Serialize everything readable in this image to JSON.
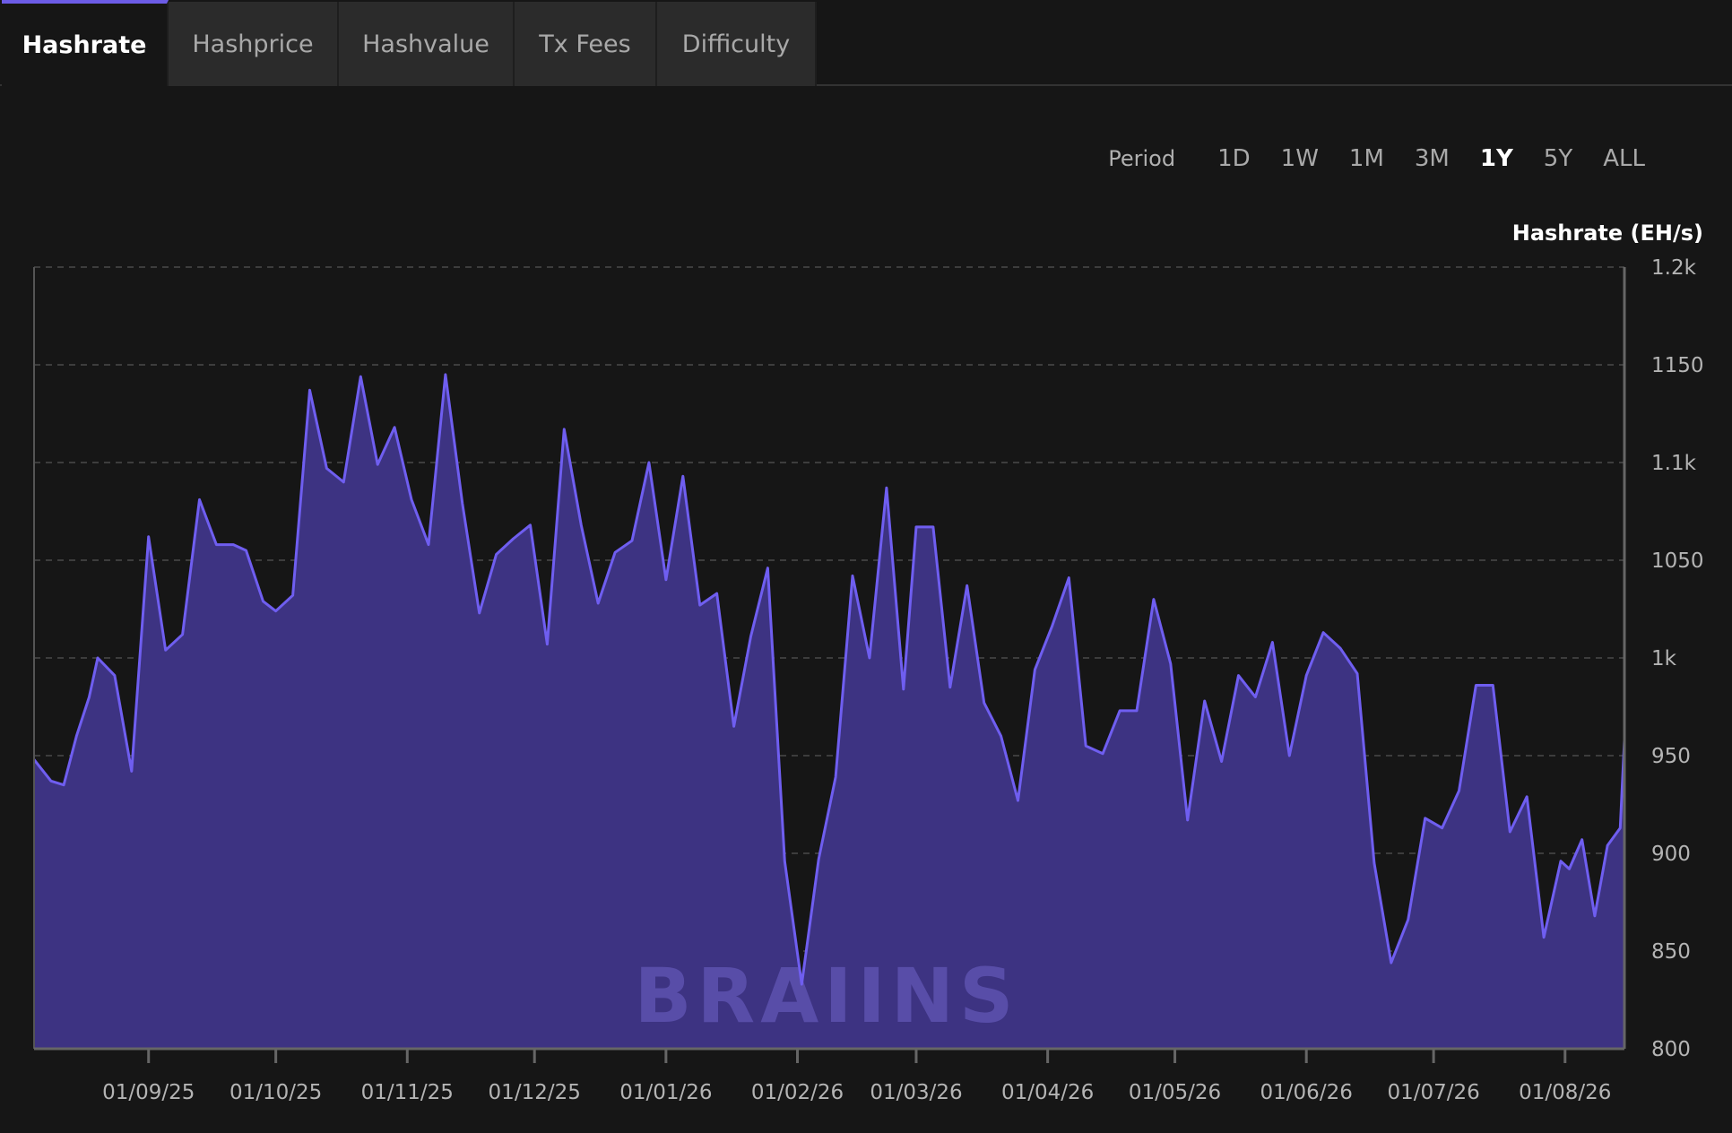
{
  "tabs": [
    {
      "label": "Hashrate",
      "active": true
    },
    {
      "label": "Hashprice",
      "active": false
    },
    {
      "label": "Hashvalue",
      "active": false
    },
    {
      "label": "Tx Fees",
      "active": false
    },
    {
      "label": "Difficulty",
      "active": false
    }
  ],
  "period": {
    "label": "Period",
    "options": [
      "1D",
      "1W",
      "1M",
      "3M",
      "1Y",
      "5Y",
      "ALL"
    ],
    "selected": "1Y"
  },
  "watermark": "BRAIINS",
  "colors": {
    "accent": "#6c5ce7",
    "line": "#6f5ef0",
    "area": "#3d3382",
    "background": "#161616"
  },
  "chart_data": {
    "type": "area",
    "ylabel": "Hashrate (EH/s)",
    "y_ticks": [
      800,
      850,
      900,
      950,
      1000,
      1050,
      1100,
      1150,
      1200
    ],
    "y_tick_labels": [
      "800",
      "850",
      "900",
      "950",
      "1k",
      "1050",
      "1.1k",
      "1150",
      "1.2k"
    ],
    "ylim": [
      800,
      1200
    ],
    "y_scale": "linear",
    "x_range": [
      "2025-08-05",
      "2026-08-15"
    ],
    "x_ticks": [
      "2025-09-01",
      "2025-10-01",
      "2025-11-01",
      "2025-12-01",
      "2026-01-01",
      "2026-02-01",
      "2026-03-01",
      "2026-04-01",
      "2026-05-01",
      "2026-06-01",
      "2026-07-01",
      "2026-08-01"
    ],
    "x_tick_labels": [
      "01/09/25",
      "01/10/25",
      "01/11/25",
      "01/12/25",
      "01/01/26",
      "01/02/26",
      "01/03/26",
      "01/04/26",
      "01/05/26",
      "01/06/26",
      "01/07/26",
      "01/08/26"
    ],
    "grid": true,
    "series": [
      {
        "values": [
          [
            "2025-08-05",
            948
          ],
          [
            "2025-08-09",
            937
          ],
          [
            "2025-08-12",
            935
          ],
          [
            "2025-08-15",
            960
          ],
          [
            "2025-08-18",
            980
          ],
          [
            "2025-08-20",
            1000
          ],
          [
            "2025-08-24",
            991
          ],
          [
            "2025-08-28",
            942
          ],
          [
            "2025-09-01",
            1062
          ],
          [
            "2025-09-05",
            1004
          ],
          [
            "2025-09-09",
            1012
          ],
          [
            "2025-09-13",
            1081
          ],
          [
            "2025-09-17",
            1058
          ],
          [
            "2025-09-21",
            1058
          ],
          [
            "2025-09-24",
            1055
          ],
          [
            "2025-09-28",
            1029
          ],
          [
            "2025-10-01",
            1024
          ],
          [
            "2025-10-05",
            1032
          ],
          [
            "2025-10-09",
            1137
          ],
          [
            "2025-10-13",
            1097
          ],
          [
            "2025-10-17",
            1090
          ],
          [
            "2025-10-21",
            1144
          ],
          [
            "2025-10-25",
            1099
          ],
          [
            "2025-10-29",
            1118
          ],
          [
            "2025-11-02",
            1081
          ],
          [
            "2025-11-06",
            1058
          ],
          [
            "2025-11-10",
            1145
          ],
          [
            "2025-11-14",
            1079
          ],
          [
            "2025-11-18",
            1023
          ],
          [
            "2025-11-22",
            1053
          ],
          [
            "2025-11-26",
            1061
          ],
          [
            "2025-11-30",
            1068
          ],
          [
            "2025-12-04",
            1007
          ],
          [
            "2025-12-08",
            1117
          ],
          [
            "2025-12-12",
            1068
          ],
          [
            "2025-12-16",
            1028
          ],
          [
            "2025-12-20",
            1054
          ],
          [
            "2025-12-24",
            1060
          ],
          [
            "2025-12-28",
            1100
          ],
          [
            "2026-01-01",
            1040
          ],
          [
            "2026-01-05",
            1093
          ],
          [
            "2026-01-09",
            1027
          ],
          [
            "2026-01-13",
            1033
          ],
          [
            "2026-01-17",
            965
          ],
          [
            "2026-01-21",
            1011
          ],
          [
            "2026-01-25",
            1046
          ],
          [
            "2026-01-29",
            896
          ],
          [
            "2026-02-02",
            833
          ],
          [
            "2026-02-06",
            897
          ],
          [
            "2026-02-10",
            939
          ],
          [
            "2026-02-14",
            1042
          ],
          [
            "2026-02-18",
            1000
          ],
          [
            "2026-02-22",
            1087
          ],
          [
            "2026-02-26",
            984
          ],
          [
            "2026-03-01",
            1067
          ],
          [
            "2026-03-05",
            1067
          ],
          [
            "2026-03-09",
            985
          ],
          [
            "2026-03-13",
            1037
          ],
          [
            "2026-03-17",
            977
          ],
          [
            "2026-03-21",
            960
          ],
          [
            "2026-03-25",
            927
          ],
          [
            "2026-03-29",
            994
          ],
          [
            "2026-04-02",
            1016
          ],
          [
            "2026-04-06",
            1041
          ],
          [
            "2026-04-10",
            955
          ],
          [
            "2026-04-14",
            951
          ],
          [
            "2026-04-18",
            973
          ],
          [
            "2026-04-22",
            973
          ],
          [
            "2026-04-26",
            1030
          ],
          [
            "2026-04-30",
            997
          ],
          [
            "2026-05-04",
            917
          ],
          [
            "2026-05-08",
            978
          ],
          [
            "2026-05-12",
            947
          ],
          [
            "2026-05-16",
            991
          ],
          [
            "2026-05-20",
            980
          ],
          [
            "2026-05-24",
            1008
          ],
          [
            "2026-05-28",
            950
          ],
          [
            "2026-06-01",
            991
          ],
          [
            "2026-06-05",
            1013
          ],
          [
            "2026-06-09",
            1005
          ],
          [
            "2026-06-13",
            992
          ],
          [
            "2026-06-17",
            895
          ],
          [
            "2026-06-21",
            844
          ],
          [
            "2026-06-25",
            866
          ],
          [
            "2026-06-29",
            918
          ],
          [
            "2026-07-03",
            913
          ],
          [
            "2026-07-07",
            932
          ],
          [
            "2026-07-11",
            986
          ],
          [
            "2026-07-15",
            986
          ],
          [
            "2026-07-19",
            911
          ],
          [
            "2026-07-23",
            929
          ],
          [
            "2026-07-27",
            857
          ],
          [
            "2026-07-31",
            896
          ],
          [
            "2026-08-02",
            892
          ],
          [
            "2026-08-05",
            907
          ],
          [
            "2026-08-08",
            868
          ],
          [
            "2026-08-11",
            904
          ],
          [
            "2026-08-14",
            913
          ],
          [
            "2026-08-15",
            958
          ],
          [
            "2026-08-15",
            902
          ]
        ]
      }
    ]
  }
}
